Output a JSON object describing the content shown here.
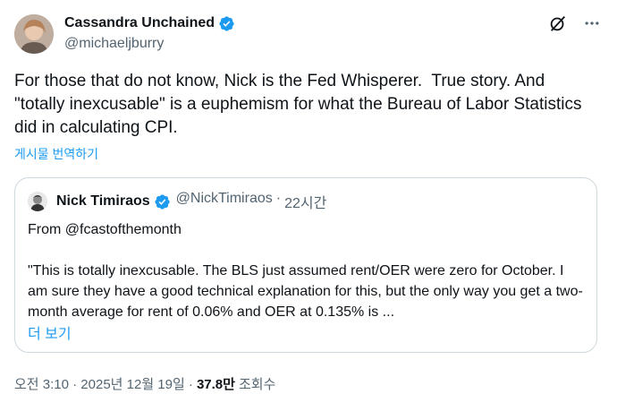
{
  "author": {
    "display_name": "Cassandra Unchained",
    "handle": "@michaeljburry",
    "verified_color": "#1d9bf0"
  },
  "icons": {
    "grok": "grok-icon",
    "more": "more-icon",
    "verified": "verified-badge-icon"
  },
  "tweet": {
    "text": "For those that do not know, Nick is the Fed Whisperer.  True story. And \"totally inexcusable\" is a euphemism for what the Bureau of Labor Statistics did in calculating CPI.",
    "translate_label": "게시물 번역하기"
  },
  "quote": {
    "display_name": "Nick Timiraos",
    "handle": "@NickTimiraos",
    "separator": "·",
    "time": "22시간",
    "body": "From @fcastofthemonth\n\n\"This is totally inexcusable. The BLS just assumed rent/OER were zero for October. I am sure they have a good technical explanation for this, but the only way you get a two-month average for rent of 0.06% and OER at 0.135% is ...",
    "show_more_label": "더 보기"
  },
  "footer": {
    "timestamp": "오전 3:10 · 2025년 12월 19일 ·",
    "views_count": "37.8만",
    "views_label": "조회수"
  }
}
